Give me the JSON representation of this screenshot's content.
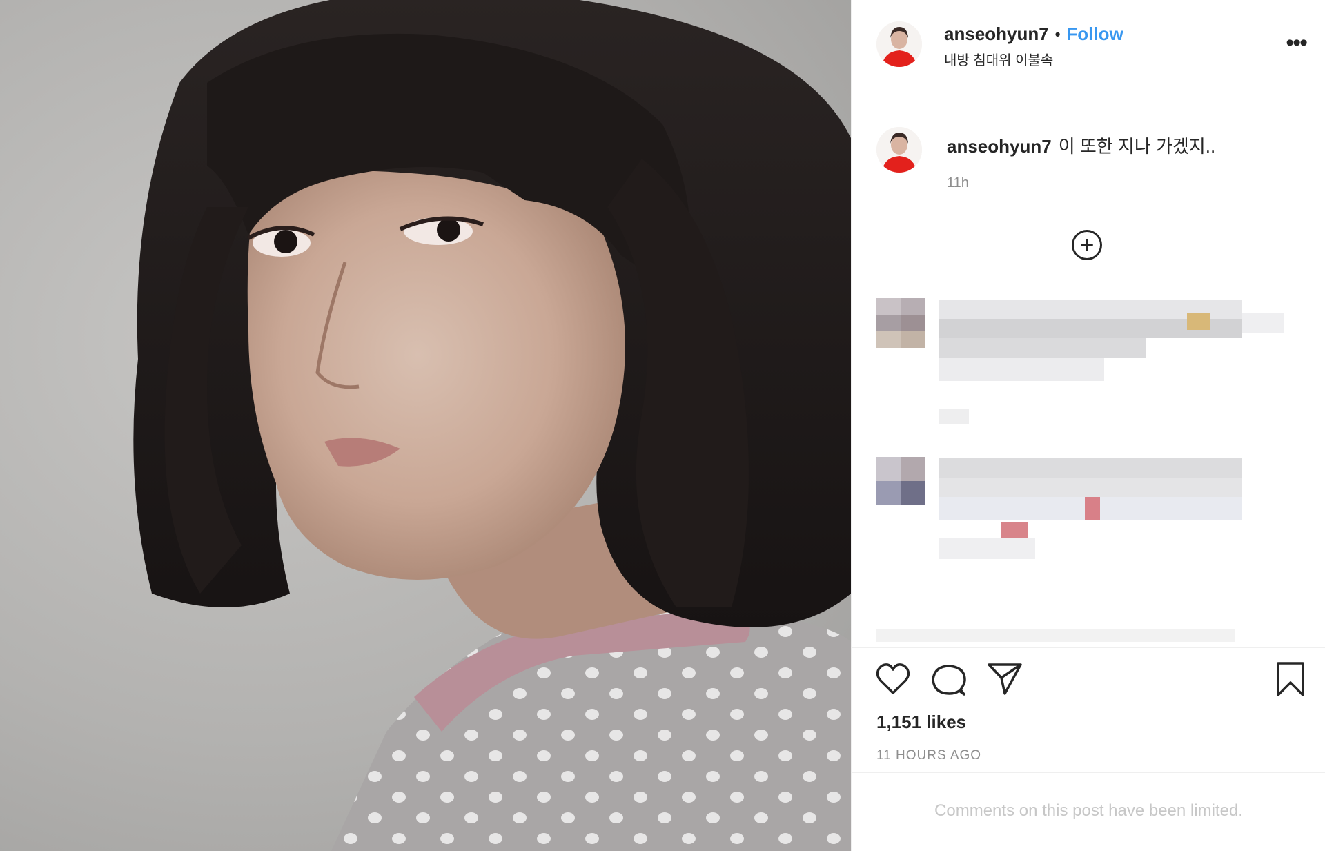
{
  "post": {
    "username": "anseohyun7",
    "separator": "•",
    "follow_label": "Follow",
    "location": "내방 침대위 이불속",
    "more_label": "•••"
  },
  "caption": {
    "username": "anseohyun7",
    "text": "이 또한 지나 가겠지..",
    "time": "11h"
  },
  "load_more": {
    "icon": "plus-circle-icon",
    "label": "+"
  },
  "actions": {
    "icons": [
      "heart-icon",
      "comment-icon",
      "share-icon",
      "bookmark-icon"
    ],
    "likes": "1,151 likes",
    "time_ago": "11 HOURS AGO",
    "comments_limited": "Comments on this post have been limited."
  },
  "colors": {
    "link_blue": "#3897f0",
    "text": "#262626",
    "muted": "#8e8e8e",
    "border": "#efefef"
  }
}
